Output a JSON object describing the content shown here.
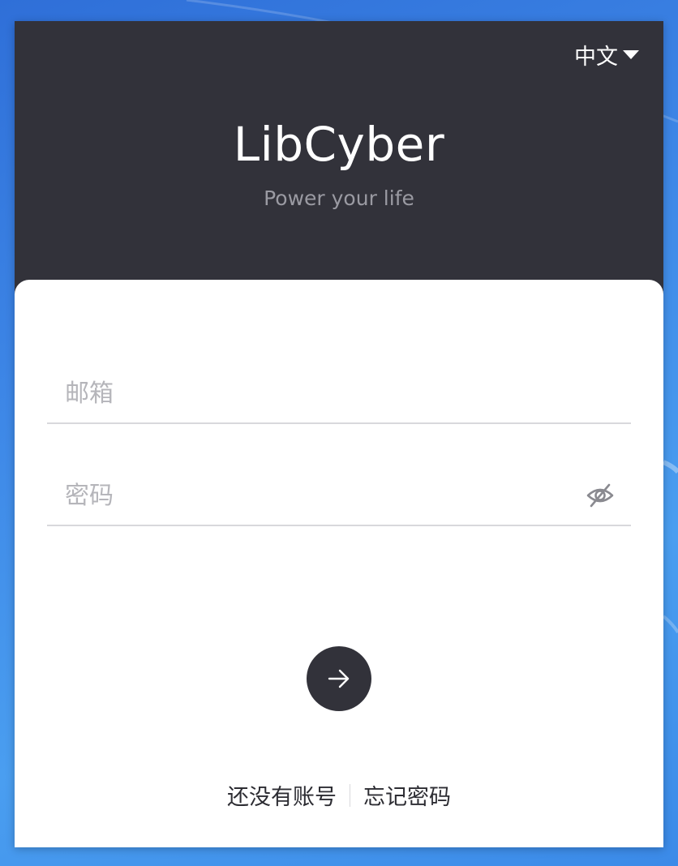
{
  "header": {
    "language_label": "中文",
    "app_title": "LibCyber",
    "tagline": "Power your life"
  },
  "form": {
    "email_placeholder": "邮箱",
    "email_value": "",
    "password_placeholder": "密码",
    "password_value": ""
  },
  "links": {
    "no_account": "还没有账号",
    "forgot_password": "忘记密码"
  },
  "icons": {
    "language_dropdown": "caret-down-icon",
    "password_visibility": "eye-off-icon",
    "submit": "arrow-right-icon"
  },
  "colors": {
    "header_background": "#32323a",
    "card_background": "#ffffff",
    "desktop_background": "#3d86e6",
    "tagline": "#9a9aa2",
    "placeholder": "#b5b5ba"
  }
}
